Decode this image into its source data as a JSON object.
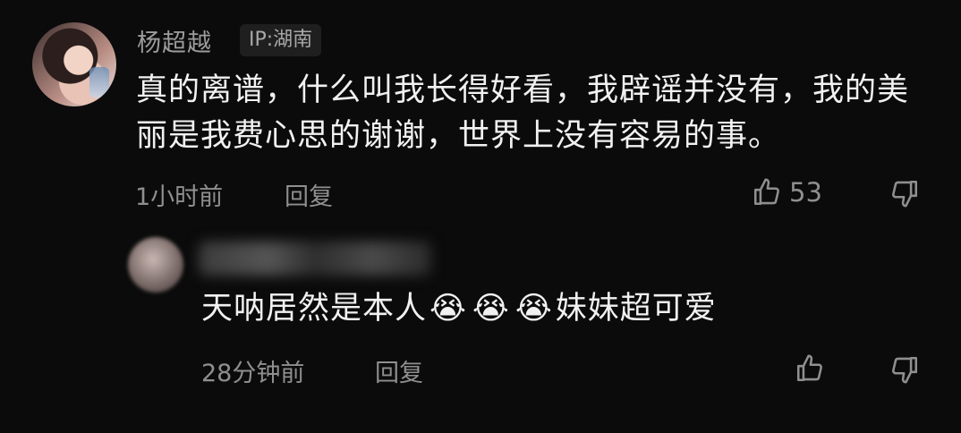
{
  "comments": [
    {
      "username": "杨超越",
      "ip_location": "IP:湖南",
      "text": "真的离谱，什么叫我长得好看，我辟谣并没有，我的美丽是我费心思的谢谢，世界上没有容易的事。",
      "time": "1小时前",
      "reply_label": "回复",
      "likes": "53"
    },
    {
      "text_before": "天呐居然是本人",
      "emoji": [
        "😭",
        "😭",
        "😭"
      ],
      "text_after": "妹妹超可爱",
      "time": "28分钟前",
      "reply_label": "回复"
    }
  ],
  "icons": {
    "like": "thumbs-up-icon",
    "dislike": "thumbs-down-icon"
  },
  "colors": {
    "background": "#0b0b0b",
    "text": "#f1f1f1",
    "muted": "#8f8f8f"
  }
}
